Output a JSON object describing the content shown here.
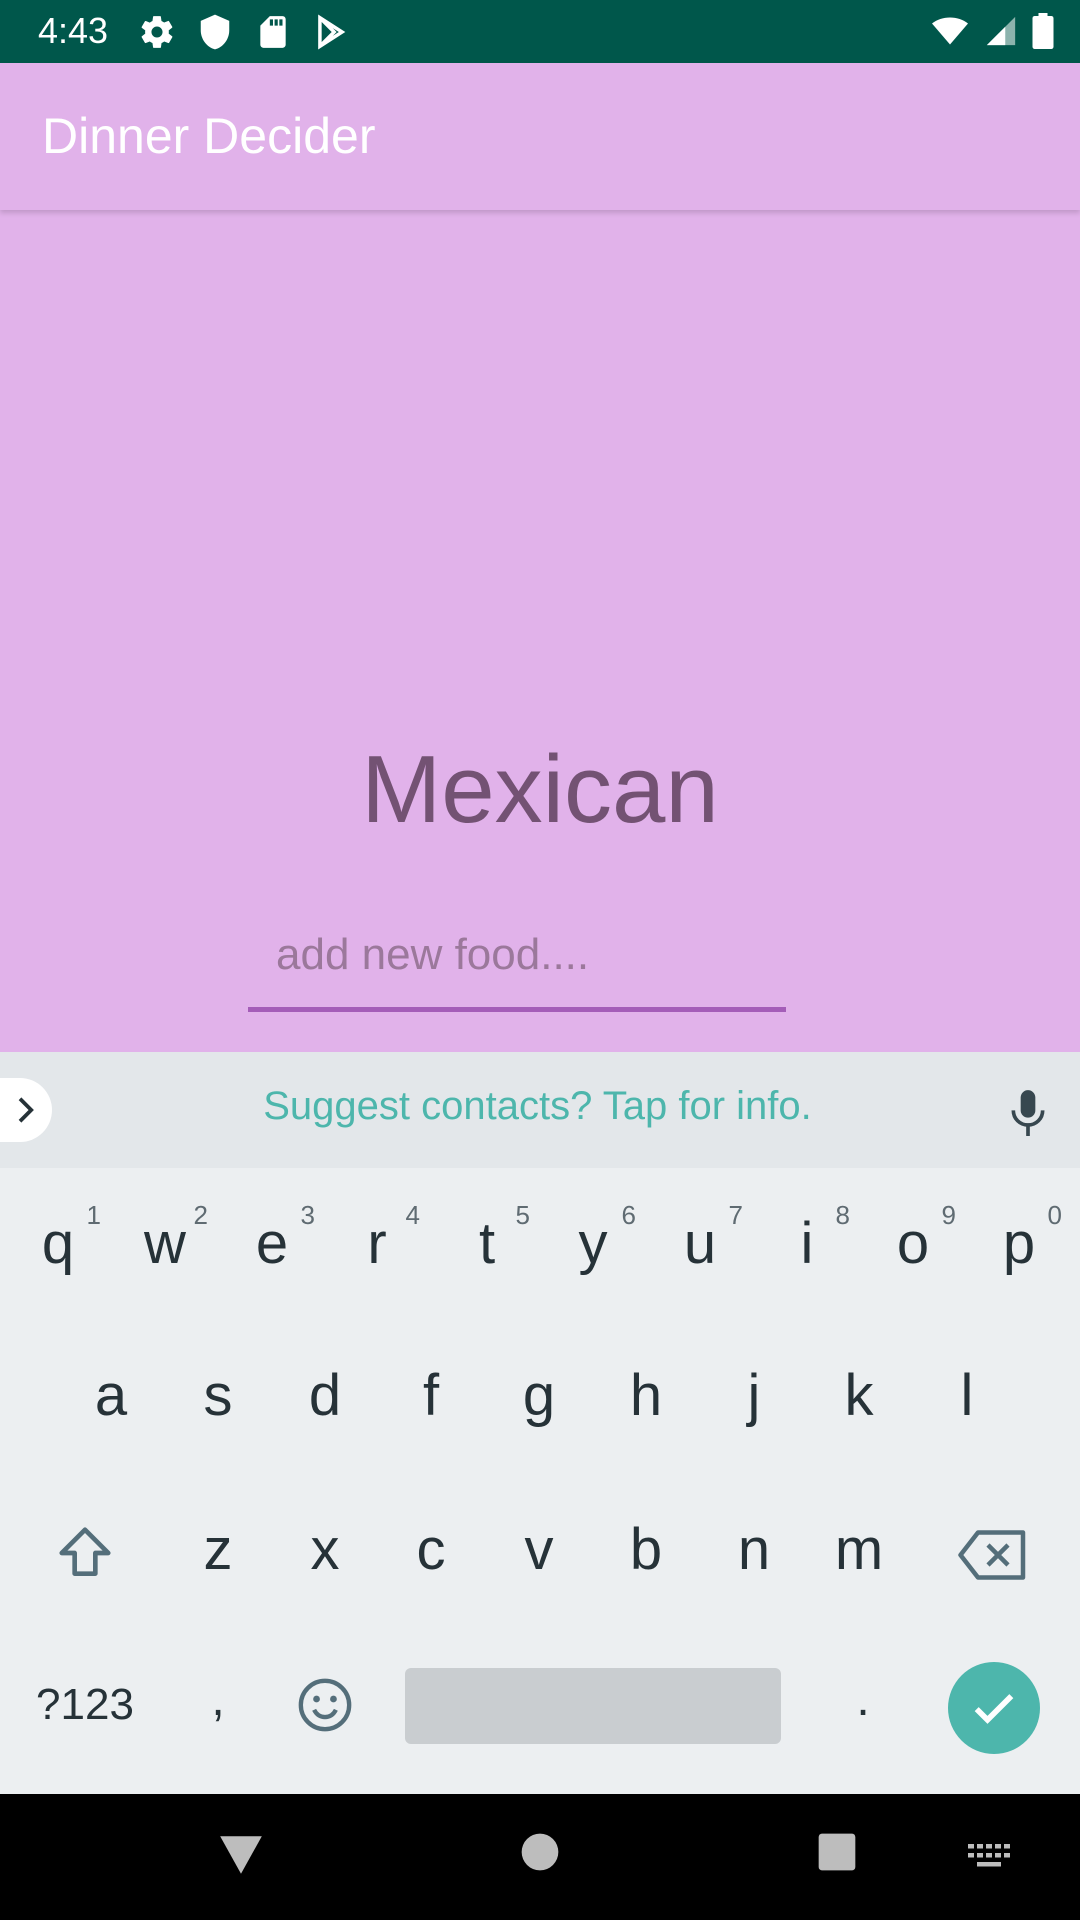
{
  "status_bar": {
    "time": "4:43",
    "left_icons": [
      "gear-icon",
      "shield-icon",
      "sd-card-icon",
      "play-store-icon"
    ],
    "right_icons": [
      "wifi-icon",
      "signal-icon",
      "battery-icon"
    ]
  },
  "app_bar": {
    "title": "Dinner Decider"
  },
  "main": {
    "selected_food": "Mexican",
    "food_input": {
      "value": "",
      "placeholder": "add new food...."
    }
  },
  "keyboard": {
    "suggestion": "Suggest contacts? Tap for info.",
    "row1": [
      {
        "key": "q",
        "hint": "1"
      },
      {
        "key": "w",
        "hint": "2"
      },
      {
        "key": "e",
        "hint": "3"
      },
      {
        "key": "r",
        "hint": "4"
      },
      {
        "key": "t",
        "hint": "5"
      },
      {
        "key": "y",
        "hint": "6"
      },
      {
        "key": "u",
        "hint": "7"
      },
      {
        "key": "i",
        "hint": "8"
      },
      {
        "key": "o",
        "hint": "9"
      },
      {
        "key": "p",
        "hint": "0"
      }
    ],
    "row2": [
      "a",
      "s",
      "d",
      "f",
      "g",
      "h",
      "j",
      "k",
      "l"
    ],
    "row3": [
      "z",
      "x",
      "c",
      "v",
      "b",
      "n",
      "m"
    ],
    "symbols_label": "?123",
    "comma_label": ",",
    "period_label": "."
  },
  "colors": {
    "status_bar": "#00574B",
    "app_background": "#E1B2EA",
    "accent": "#A45DB8",
    "keyboard_accent": "#4DB6AC"
  }
}
